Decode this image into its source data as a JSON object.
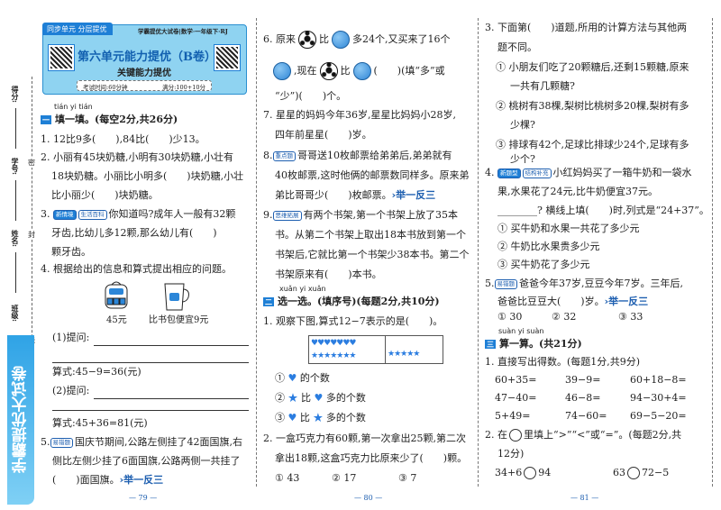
{
  "binding": {
    "labels": [
      "得分:",
      "学号:",
      "姓名:",
      "班级:"
    ],
    "seal_chars": [
      "密",
      "封",
      "线"
    ],
    "brand": "学霸提优大试卷"
  },
  "header": {
    "tab": "同步单元 分层提优",
    "series": "学霸提优大试卷|数学·一年级下·RJ",
    "title": "第六单元能力提优（B卷）",
    "subtitle": "关键能力提优",
    "time": "考试时间:60分钟",
    "score": "满分:100+10分"
  },
  "left": {
    "sec1_pinyin": "tián yi tián",
    "sec1_icon": "一",
    "sec1_title": "填一填。(每空2分,共26分)",
    "q1": "1. 12比9多(　　),84比(　　)少13。",
    "q2": [
      "2. 小丽有45块奶糖,小明有30块奶糖,小壮有",
      "18块奶糖。小丽比小明多(　　)块奶糖,小壮",
      "比小丽少(　　)块奶糖。"
    ],
    "q3_num": "3.",
    "q3_tags": [
      "新情境",
      "生活百科"
    ],
    "q3": [
      "你知道吗?成年人一般有32颗",
      "牙齿,比幼儿多12颗,那么幼儿有(　　)",
      "颗牙齿。"
    ],
    "q4": "4. 根据给出的信息和算式提出相应的问题。",
    "bag_price": "45元",
    "cup_caption": "比书包便宜9元",
    "ask1": "(1)提问:",
    "eq1": "算式:45−9=36(元)",
    "ask2": "(2)提问:",
    "eq2": "算式:45+36=81(元)",
    "q5_num": "5.",
    "q5_tag": "易错题",
    "q5": [
      "国庆节期间,公路左侧挂了42面国旗,右",
      "侧比左侧少挂了6面国旗,公路两侧一共挂了",
      "(　　)面国旗。"
    ],
    "q5_link": "›举一反三",
    "page": "— 79 —"
  },
  "middle": {
    "q6a": "6. 原来",
    "q6b": "比",
    "q6c": "多24个,又买来了16个",
    "q6d": ",现在",
    "q6e": "比",
    "q6f": "(　　)(填“多”或",
    "q6g": "“少”)(　　)个。",
    "q7": [
      "7. 星星的妈妈今年36岁,星星比妈妈小28岁,",
      "四年前星星(　　)岁。"
    ],
    "q8_num": "8.",
    "q8_tag": "重点题",
    "q8": [
      "哥哥送10枚邮票给弟弟后,弟弟就有",
      "40枚邮票,这时他俩的邮票数同样多。原来弟",
      "弟比哥哥少(　　)枚邮票。"
    ],
    "q8_link": "›举一反三",
    "q9_num": "9.",
    "q9_tag": "思维拓展",
    "q9": [
      "有两个书架,第一个书架上放了35本",
      "书。从第二个书架上取出18本书放到第一个",
      "书架后,它就比第一个书架少38本书。第二个",
      "书架原来有(　　)本书。"
    ],
    "sec2_pinyin": "xuǎn yi xuǎn",
    "sec2_icon": "二",
    "sec2_title": "选一选。(填序号)(每题2分,共10分)",
    "s1": "1. 观察下图,算式12−7表示的是(　　)。",
    "hearts": "♥♥♥♥♥♥♥",
    "stars_left": "★★★★★★★",
    "stars_right": "★★★★★",
    "opt1": [
      "①",
      "的个数"
    ],
    "opt2": [
      "②",
      "比",
      "多的个数"
    ],
    "opt3": [
      "③",
      "比",
      "多的个数"
    ],
    "s2": [
      "2. 一盒巧克力有60颗,第一次拿出25颗,第二次",
      "拿出18颗,这盒巧克力比原来少了(　　)颗。"
    ],
    "s2_opts": [
      "① 43",
      "② 17",
      "③ 7"
    ],
    "page": "— 80 —"
  },
  "right": {
    "q3": [
      "3. 下面第(　　)道题,所用的计算方法与其他两",
      "题不同。"
    ],
    "q3_opts": [
      [
        "① 小朋友们吃了20颗糖后,还剩15颗糖,原来",
        "一共有几颗糖?"
      ],
      [
        "② 桃树有38棵,梨树比桃树多20棵,梨树有多",
        "少棵?"
      ],
      [
        "③ 排球有42个,足球比排球少24个,足球有多",
        "少个?"
      ]
    ],
    "q4_num": "4.",
    "q4_tags": [
      "新题型",
      "结构补充"
    ],
    "q4": [
      "小红妈妈买了一箱牛奶和一袋水",
      "果,水果花了24元,比牛奶便宜37元。",
      "________? 横线上填(　　)时,列式是“24+37”。"
    ],
    "q4_opts": [
      "① 买牛奶和水果一共花了多少元",
      "② 牛奶比水果贵多少元",
      "③ 买牛奶花了多少元"
    ],
    "q5_num": "5.",
    "q5_tag": "易错题",
    "q5": [
      "爸爸今年37岁,豆豆今年7岁。三年后,",
      "爸爸比豆豆大(　　)岁。"
    ],
    "q5_link": "›举一反三",
    "q5_opts": [
      "① 30",
      "② 32",
      "③ 33"
    ],
    "sec3_pinyin": "suàn yi suàn",
    "sec3_icon": "三",
    "sec3_title": "算一算。(共21分)",
    "c1": "1. 直接写出得数。(每题1分,共9分)",
    "calc": [
      [
        "60+35=",
        "39−9=",
        "60+18−8="
      ],
      [
        "47−40=",
        "46−8=",
        "94−30+4="
      ],
      [
        "5+49=",
        "74−60=",
        "69−5−20="
      ]
    ],
    "c2a": "2. 在",
    "c2b": "里填上“>”“<”或“=”。(每题2分,共",
    "c2c": "12分)",
    "cmp": [
      [
        "34+6",
        "94"
      ],
      [
        "63",
        "72−5"
      ]
    ],
    "page": "— 81 —"
  }
}
